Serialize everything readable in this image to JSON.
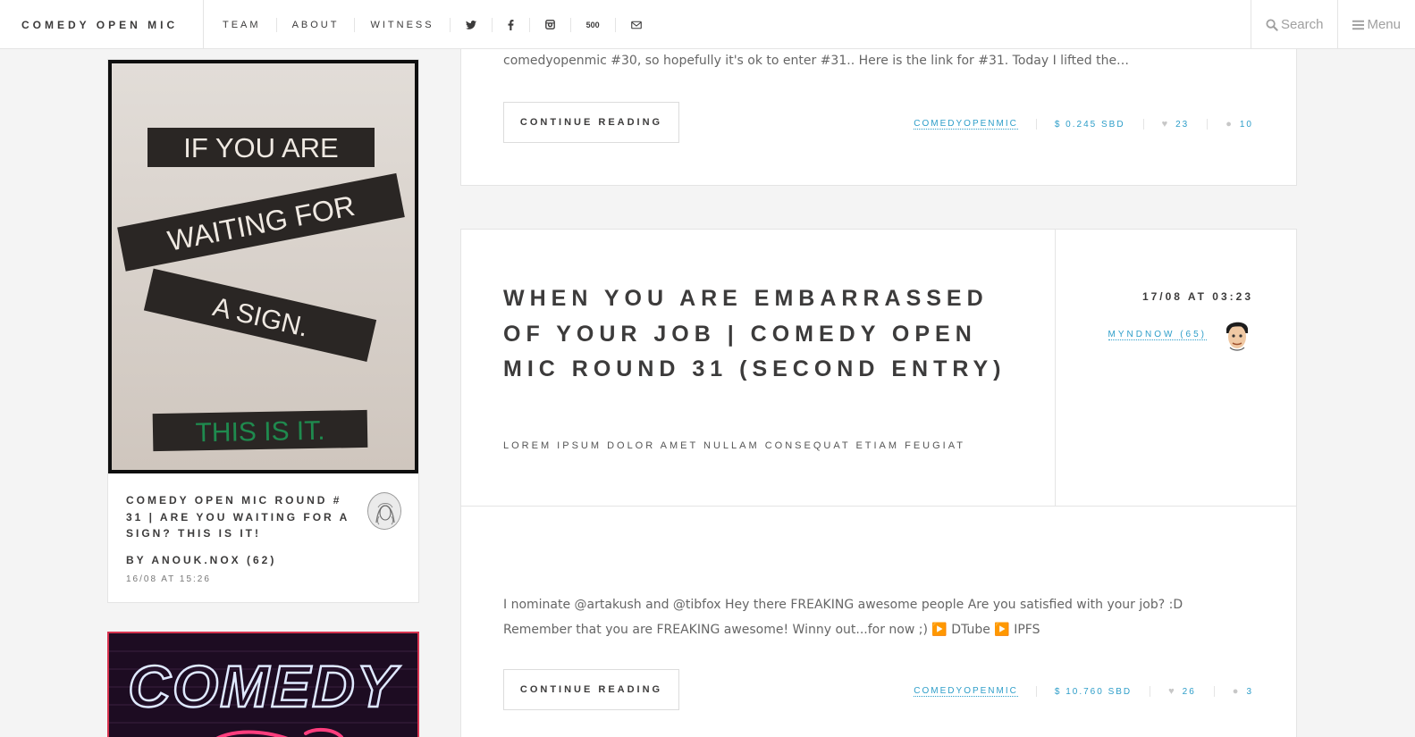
{
  "header": {
    "logo": "COMEDY OPEN MIC",
    "nav": [
      {
        "label": "TEAM"
      },
      {
        "label": "ABOUT"
      },
      {
        "label": "WITNESS"
      }
    ],
    "social_icons": [
      "twitter-icon",
      "facebook-icon",
      "instagram-icon",
      "500px-icon",
      "envelope-icon"
    ],
    "social_500_label": "500",
    "search_label": "Search",
    "menu_label": "Menu"
  },
  "sidebar": {
    "post": {
      "image_text": [
        "IF YOU ARE",
        "WAITING FOR",
        "A SIGN.",
        "THIS IS IT."
      ],
      "title": "COMEDY OPEN MIC ROUND # 31 | ARE YOU WAITING FOR A SIGN? THIS IS IT!",
      "author_prefix": "BY",
      "author": "ANOUK.NOX (62)",
      "date": "16/08 AT 15:26"
    },
    "next_post": {
      "image_text": "COMEDY"
    }
  },
  "posts": [
    {
      "excerpt": "comedyopenmic #30, so hopefully it's ok to enter #31.. Here is the link for #31. Today I lifted the…",
      "continue_label": "CONTINUE READING",
      "tag": "COMEDYOPENMIC",
      "payout": "$ 0.245 SBD",
      "likes": "23",
      "comments": "10"
    },
    {
      "title": "WHEN YOU ARE EMBARRASSED OF YOUR JOB | COMEDY OPEN MIC ROUND 31 (SECOND ENTRY)",
      "subtitle": "LOREM IPSUM DOLOR AMET NULLAM CONSEQUAT ETIAM FEUGIAT",
      "date": "17/08 AT 03:23",
      "author": "MYNDNOW (65)",
      "excerpt": "I nominate @artakush and @tibfox Hey there FREAKING awesome people Are you satisfied with your job? :D Remember that you are FREAKING awesome! Winny out...for now ;) ▶️ DTube ▶️ IPFS",
      "continue_label": "CONTINUE READING",
      "tag": "COMEDYOPENMIC",
      "payout": "$ 10.760 SBD",
      "likes": "26",
      "comments": "3"
    }
  ],
  "colors": {
    "accent": "#2e9ec9",
    "text": "#3c3b3b",
    "background": "#f4f4f4"
  }
}
